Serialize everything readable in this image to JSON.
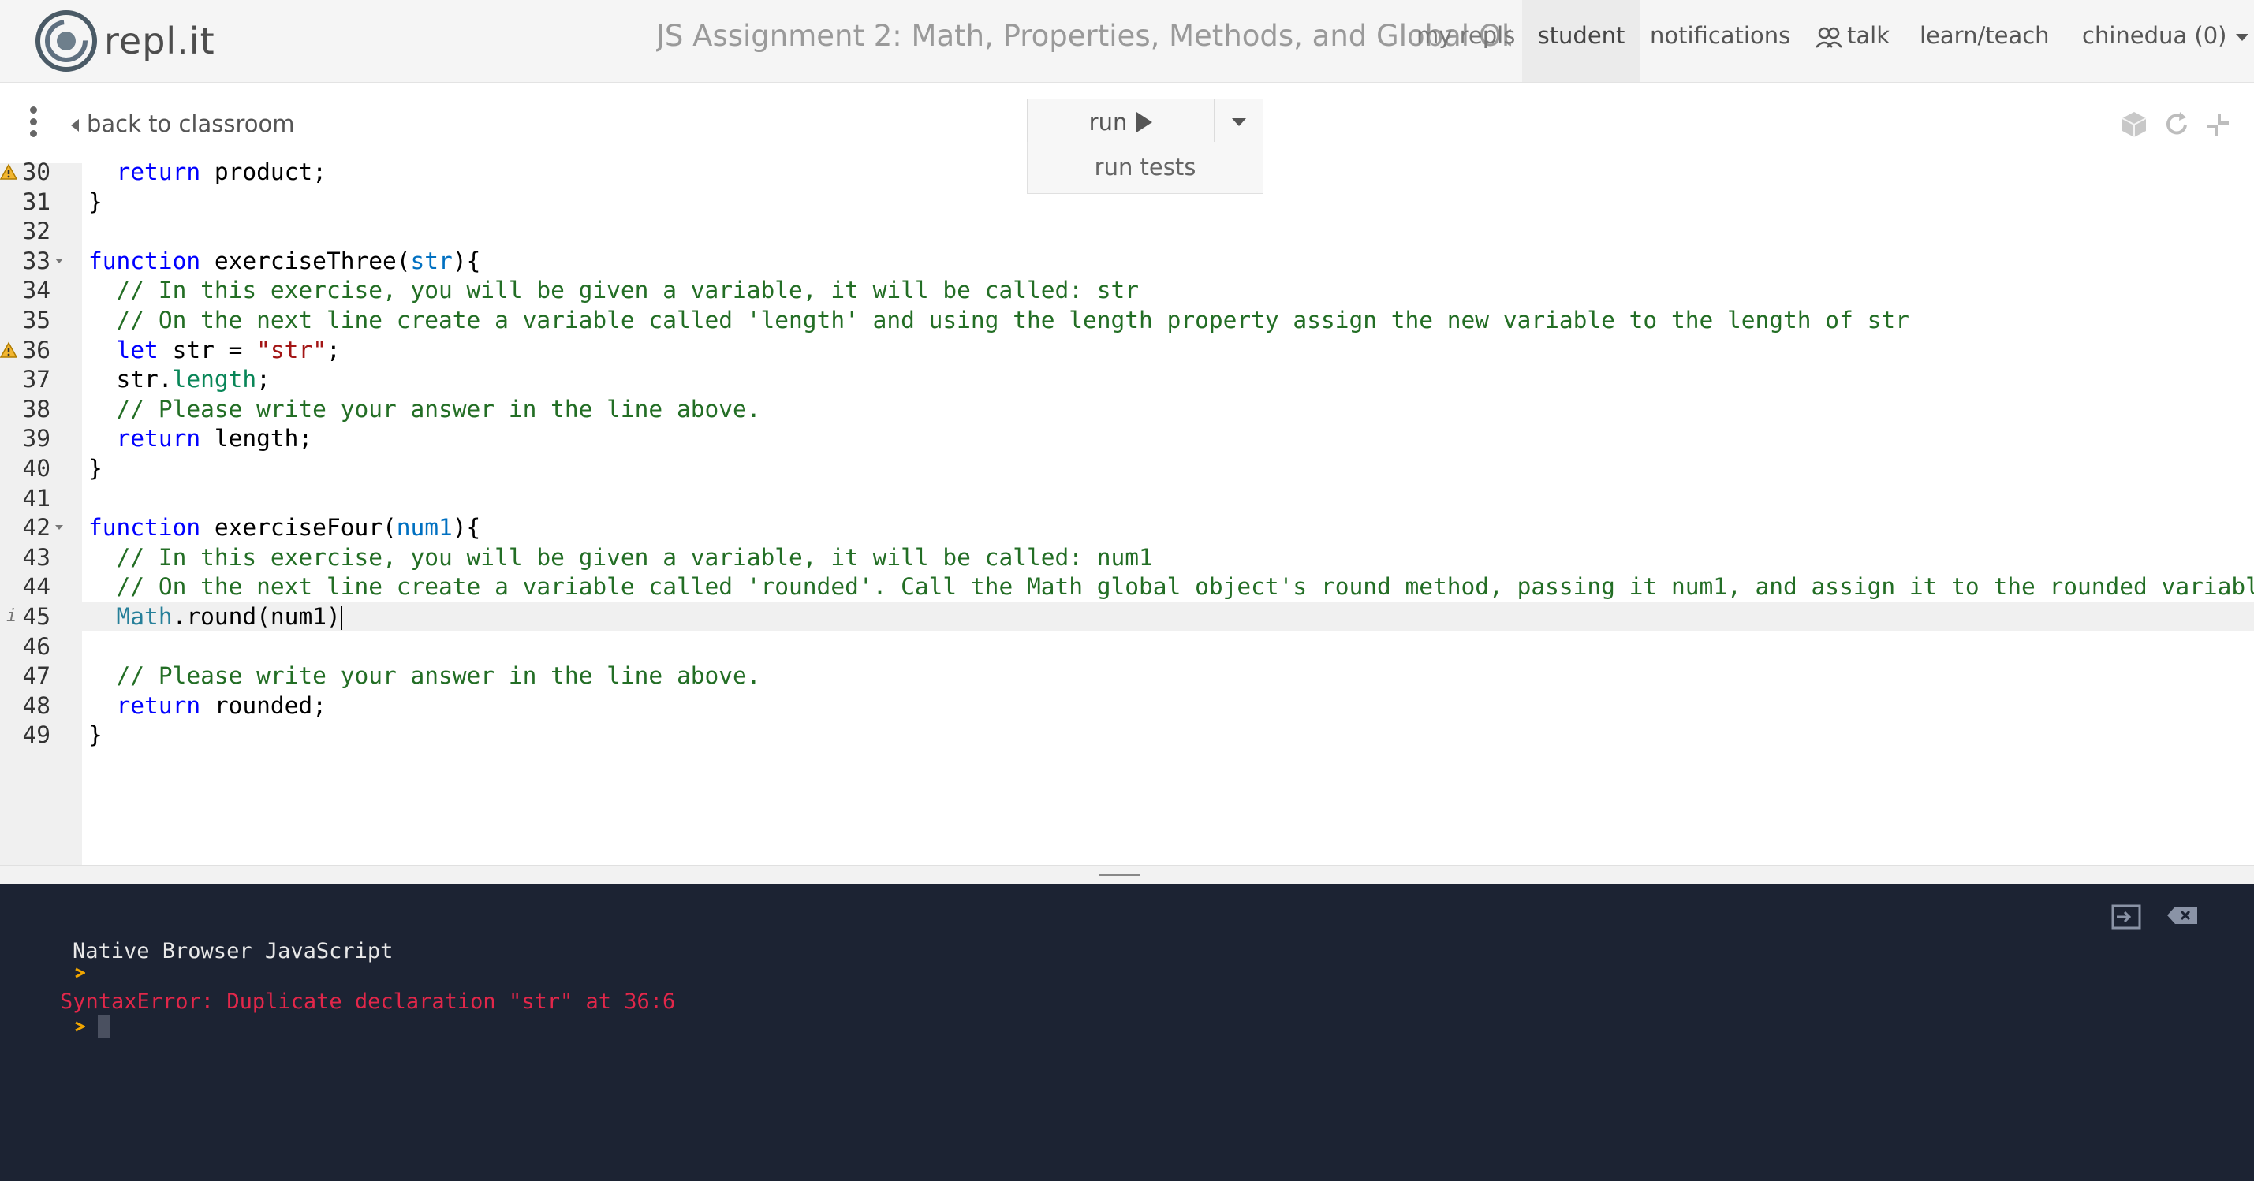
{
  "app": {
    "logo_text": "repl.it"
  },
  "header": {
    "title": "JS Assignment 2: Math, Properties, Methods, and Global Objects",
    "nav": {
      "my_repls": "my repls",
      "student": "student",
      "notifications": "notifications",
      "talk": "talk",
      "learn_teach": "learn/teach",
      "user": "chinedua (0)"
    }
  },
  "toolbar": {
    "back_label": "back to classroom",
    "run_label": "run",
    "run_menu": [
      "run tests"
    ]
  },
  "editor": {
    "active_line": 45,
    "lines": [
      {
        "n": "30",
        "code": "  return product;"
      },
      {
        "n": "31",
        "code": "}"
      },
      {
        "n": "32",
        "code": ""
      },
      {
        "n": "33",
        "code": "function exerciseThree(str){"
      },
      {
        "n": "34",
        "code": "  // In this exercise, you will be given a variable, it will be called: str"
      },
      {
        "n": "35",
        "code": "  // On the next line create a variable called 'length' and using the length property assign the new variable to the length of str"
      },
      {
        "n": "36",
        "code": "  let str = \"str\";"
      },
      {
        "n": "37",
        "code": "  str.length;"
      },
      {
        "n": "38",
        "code": "  // Please write your answer in the line above."
      },
      {
        "n": "39",
        "code": "  return length;"
      },
      {
        "n": "40",
        "code": "}"
      },
      {
        "n": "41",
        "code": ""
      },
      {
        "n": "42",
        "code": "function exerciseFour(num1){"
      },
      {
        "n": "43",
        "code": "  // In this exercise, you will be given a variable, it will be called: num1"
      },
      {
        "n": "44",
        "code": "  // On the next line create a variable called 'rounded'. Call the Math global object's round method, passing it num1, and assign it to the rounded variable."
      },
      {
        "n": "45",
        "code": "  Math.round(num1)"
      },
      {
        "n": "46",
        "code": ""
      },
      {
        "n": "47",
        "code": "  // Please write your answer in the line above."
      },
      {
        "n": "48",
        "code": "  return rounded;"
      },
      {
        "n": "49",
        "code": "}"
      }
    ]
  },
  "console": {
    "header": "Native Browser JavaScript",
    "error": "SyntaxError: Duplicate declaration \"str\" at 36:6"
  },
  "colors": {
    "console_bg": "#1c2333",
    "error_red": "#e2274a",
    "keyword_blue": "#0000ff",
    "comment_green": "#236e25"
  }
}
